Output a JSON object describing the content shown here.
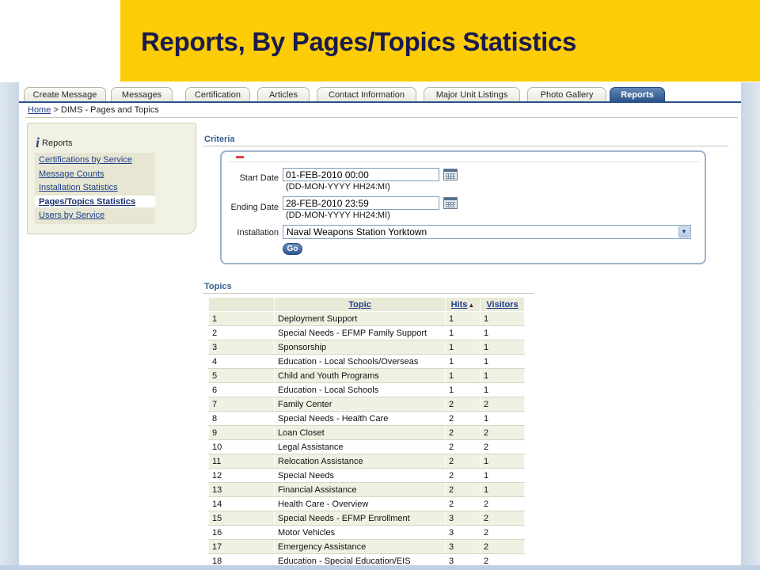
{
  "slide": {
    "title": "Reports, By Pages/Topics Statistics"
  },
  "tabs": [
    "Create Message",
    "Messages",
    "Certification",
    "Articles",
    "Contact Information",
    "Major Unit Listings",
    "Photo Gallery",
    "Reports"
  ],
  "breadcrumb": {
    "home": "Home",
    "separator": ">",
    "current": "DIMS - Pages and Topics"
  },
  "sidebar": {
    "title": "Reports",
    "items": [
      "Certifications by Service",
      "Message Counts",
      "Installation Statistics",
      "Pages/Topics Statistics",
      "Users by Service"
    ]
  },
  "criteria": {
    "heading": "Criteria",
    "start_label": "Start Date",
    "start_value": "01-FEB-2010 00:00",
    "start_hint": "(DD-MON-YYYY HH24:MI)",
    "end_label": "Ending Date",
    "end_value": "28-FEB-2010 23:59",
    "end_hint": "(DD-MON-YYYY HH24:MI)",
    "installation_label": "Installation",
    "installation_value": "Naval Weapons Station Yorktown",
    "go_label": "Go"
  },
  "topics": {
    "heading": "Topics",
    "columns": [
      "",
      "Topic",
      "Hits",
      "Visitors"
    ],
    "rows": [
      [
        "1",
        "Deployment Support",
        "1",
        "1"
      ],
      [
        "2",
        "Special Needs - EFMP Family Support",
        "1",
        "1"
      ],
      [
        "3",
        "Sponsorship",
        "1",
        "1"
      ],
      [
        "4",
        "Education - Local Schools/Overseas",
        "1",
        "1"
      ],
      [
        "5",
        "Child and Youth Programs",
        "1",
        "1"
      ],
      [
        "6",
        "Education - Local Schools",
        "1",
        "1"
      ],
      [
        "7",
        "Family Center",
        "2",
        "2"
      ],
      [
        "8",
        "Special Needs - Health Care",
        "2",
        "1"
      ],
      [
        "9",
        "Loan Closet",
        "2",
        "2"
      ],
      [
        "10",
        "Legal Assistance",
        "2",
        "2"
      ],
      [
        "11",
        "Relocation Assistance",
        "2",
        "1"
      ],
      [
        "12",
        "Special Needs",
        "2",
        "1"
      ],
      [
        "13",
        "Financial Assistance",
        "2",
        "1"
      ],
      [
        "14",
        "Health Care - Overview",
        "2",
        "2"
      ],
      [
        "15",
        "Special Needs - EFMP Enrollment",
        "3",
        "2"
      ],
      [
        "16",
        "Motor Vehicles",
        "3",
        "2"
      ],
      [
        "17",
        "Emergency Assistance",
        "3",
        "2"
      ],
      [
        "18",
        "Education - Special Education/EIS",
        "3",
        "2"
      ]
    ]
  },
  "colors": {
    "title_band": "#fccd06",
    "title_text": "#1a1a4e",
    "active_tab": "#2a5288",
    "link": "#1f3f8a"
  },
  "icons": {
    "info": "info-icon",
    "calendar": "calendar-icon",
    "sort": "sort-ascending-icon",
    "dropdown": "chevron-down-icon"
  }
}
